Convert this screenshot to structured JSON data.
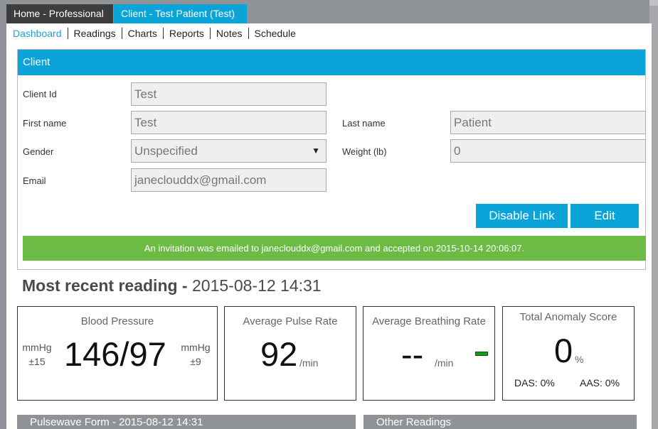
{
  "top_tabs": {
    "home": "Home - Professional",
    "client": "Client - Test Patient (Test)"
  },
  "subnav": [
    "Dashboard",
    "Readings",
    "Charts",
    "Reports",
    "Notes",
    "Schedule"
  ],
  "client": {
    "header": "Client",
    "client_id_label": "Client Id",
    "client_id": "Test",
    "first_name_label": "First name",
    "first_name": "Test",
    "last_name_label": "Last name",
    "last_name": "Patient",
    "gender_label": "Gender",
    "gender": "Unspecified",
    "weight_label": "Weight (lb)",
    "weight": "0",
    "email_label": "Email",
    "email": "janeclouddx@gmail.com",
    "disable_link": "Disable Link",
    "edit": "Edit",
    "notice": "An invitation was emailed to janeclouddx@gmail.com and accepted on 2015-10-14 20:06:07."
  },
  "recent": {
    "title": "Most recent reading -",
    "datetime": "2015-08-12 14:31"
  },
  "cards": {
    "bp": {
      "title": "Blood Pressure",
      "value": "146/97",
      "left_unit": "mmHg",
      "left_tol": "±15",
      "right_unit": "mmHg",
      "right_tol": "±9"
    },
    "pulse": {
      "title": "Average Pulse Rate",
      "value": "92",
      "unit": "/min"
    },
    "breathing": {
      "title": "Average Breathing Rate",
      "value": "--",
      "unit": "/min"
    },
    "anomaly": {
      "title": "Total Anomaly Score",
      "value": "0",
      "unit": "%",
      "das": "DAS: 0%",
      "aas": "AAS: 0%"
    }
  },
  "sections": {
    "pulsewave": "Pulsewave Form - 2015-08-12 14:31",
    "other": "Other Readings"
  },
  "colors": {
    "accent": "#0aa4d8",
    "success": "#6cbb45",
    "chrome": "#8f9297"
  }
}
